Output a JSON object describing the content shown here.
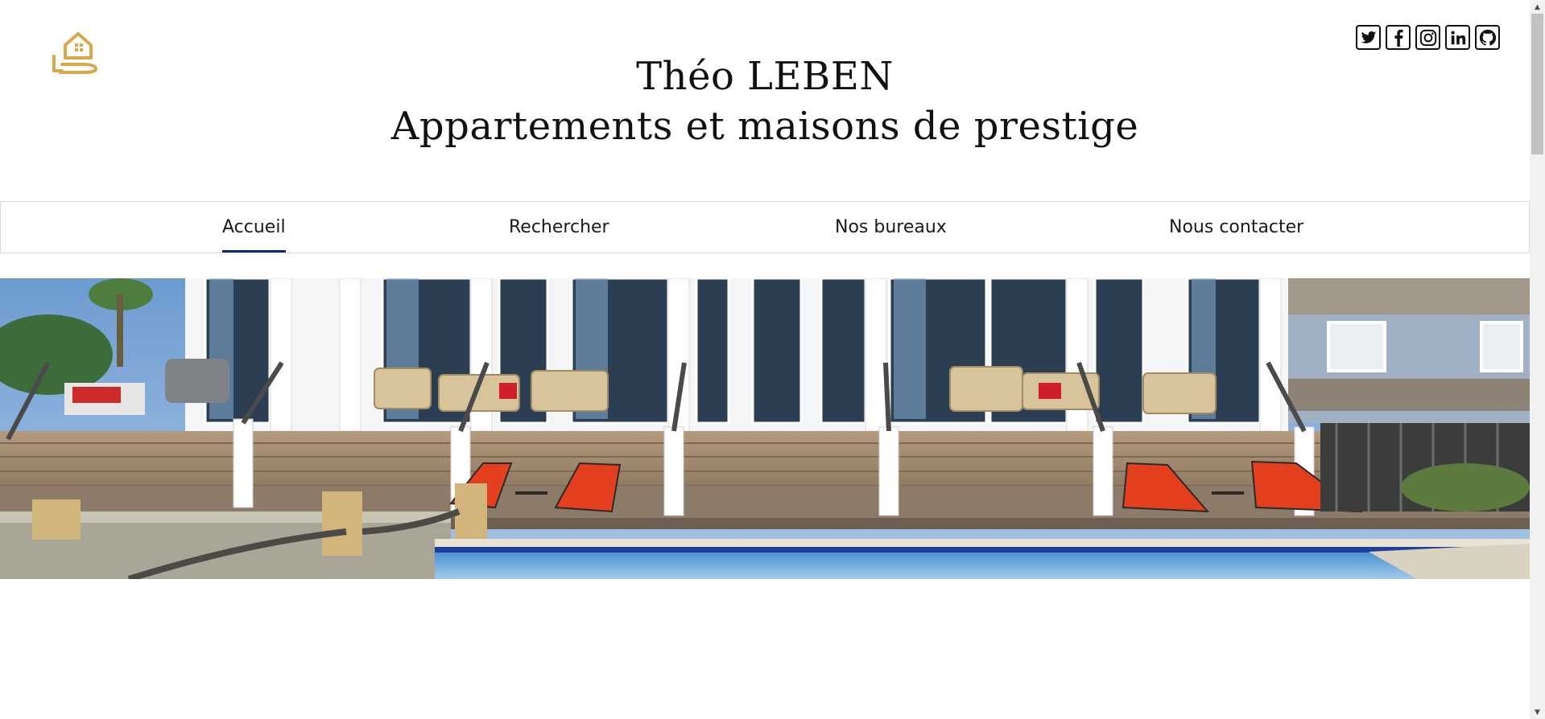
{
  "header": {
    "title": "Théo LEBEN",
    "subtitle": "Appartements et maisons de prestige"
  },
  "social": [
    {
      "icon": "twitter-icon",
      "glyph": "🐦"
    },
    {
      "icon": "facebook-icon",
      "glyph": "f"
    },
    {
      "icon": "instagram-icon",
      "glyph": "◎"
    },
    {
      "icon": "linkedin-icon",
      "glyph": "in"
    },
    {
      "icon": "github-icon",
      "glyph": "⌥"
    }
  ],
  "nav": {
    "items": [
      {
        "label": "Accueil",
        "active": true
      },
      {
        "label": "Rechercher",
        "active": false
      },
      {
        "label": "Nos bureaux",
        "active": false
      },
      {
        "label": "Nous contacter",
        "active": false
      }
    ]
  },
  "colors": {
    "accent": "#0a2a78",
    "logo": "#d9a84a"
  }
}
